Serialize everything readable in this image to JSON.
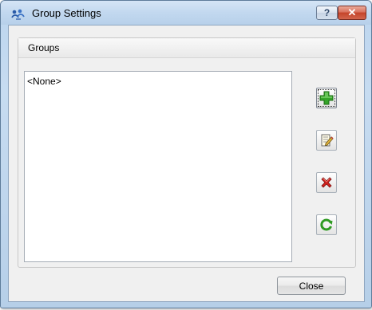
{
  "window": {
    "title": "Group Settings",
    "help_label": "?",
    "close_glyph": "✕"
  },
  "groups_panel": {
    "title": "Groups",
    "items": [
      "<None>"
    ]
  },
  "tools": [
    {
      "name": "add",
      "icon": "plus-icon"
    },
    {
      "name": "edit",
      "icon": "edit-note-icon"
    },
    {
      "name": "delete",
      "icon": "red-x-icon"
    },
    {
      "name": "refresh",
      "icon": "refresh-icon"
    }
  ],
  "footer": {
    "close_label": "Close"
  },
  "colors": {
    "titlebar": "#c2d8ef",
    "close_button": "#c4432a",
    "plus_green": "#2e9a22",
    "delete_red": "#c61b1b"
  }
}
